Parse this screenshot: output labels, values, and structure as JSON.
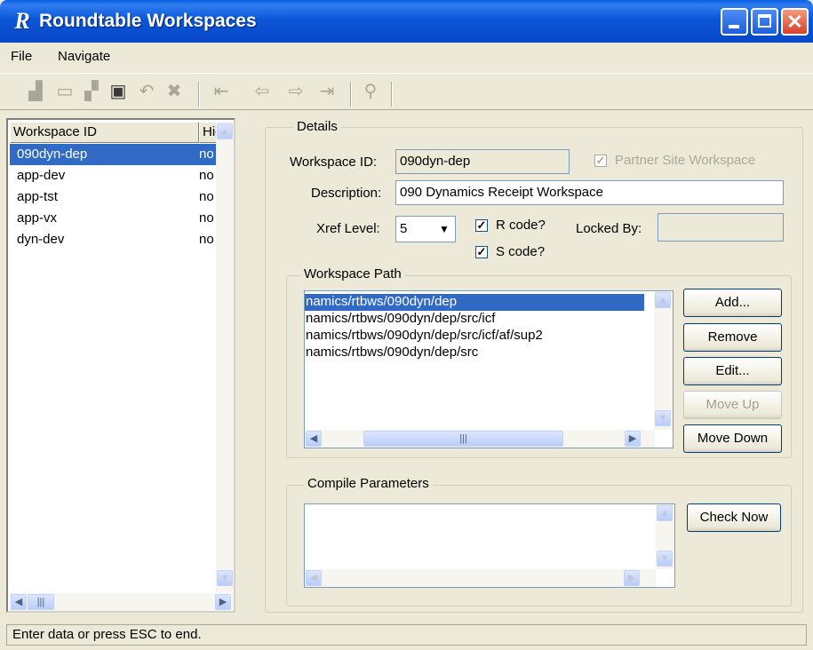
{
  "window": {
    "app_icon": "R",
    "title": "Roundtable Workspaces"
  },
  "menu": {
    "file": "File",
    "navigate": "Navigate"
  },
  "list": {
    "columns": [
      "Workspace ID",
      "Hidd"
    ],
    "rows": [
      {
        "id": "090dyn-dep",
        "hidden": "no"
      },
      {
        "id": "app-dev",
        "hidden": "no"
      },
      {
        "id": "app-tst",
        "hidden": "no"
      },
      {
        "id": "app-vx",
        "hidden": "no"
      },
      {
        "id": "dyn-dev",
        "hidden": "no"
      }
    ]
  },
  "details": {
    "group_label": "Details",
    "workspace_id_label": "Workspace ID:",
    "workspace_id_value": "090dyn-dep",
    "partner_site_label": "Partner Site Workspace",
    "description_label": "Description:",
    "description_value": "090 Dynamics Receipt Workspace",
    "xref_label": "Xref Level:",
    "xref_value": "5",
    "r_code_label": "R code?",
    "s_code_label": "S code?",
    "locked_by_label": "Locked By:",
    "locked_by_value": ""
  },
  "workspace_path": {
    "group_label": "Workspace Path",
    "items": [
      "namics/rtbws/090dyn/dep",
      "namics/rtbws/090dyn/dep/src/icf",
      "namics/rtbws/090dyn/dep/src/icf/af/sup2",
      "namics/rtbws/090dyn/dep/src"
    ],
    "buttons": {
      "add": "Add...",
      "remove": "Remove",
      "edit": "Edit...",
      "move_up": "Move Up",
      "move_down": "Move Down"
    }
  },
  "compile": {
    "group_label": "Compile Parameters",
    "check_now": "Check Now"
  },
  "status": {
    "text": "Enter data or press ESC to end."
  }
}
